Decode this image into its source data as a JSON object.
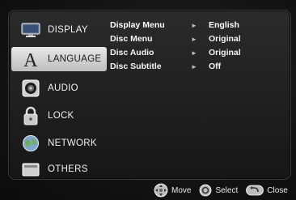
{
  "sidebar": {
    "items": [
      {
        "label": "DISPLAY",
        "icon": "display-icon"
      },
      {
        "label": "LANGUAGE",
        "icon": "language-icon"
      },
      {
        "label": "AUDIO",
        "icon": "audio-icon"
      },
      {
        "label": "LOCK",
        "icon": "lock-icon"
      },
      {
        "label": "NETWORK",
        "icon": "network-icon"
      },
      {
        "label": "OTHERS",
        "icon": "others-icon"
      }
    ],
    "selected": "LANGUAGE"
  },
  "settings": [
    {
      "label": "Display Menu",
      "value": "English"
    },
    {
      "label": "Disc Menu",
      "value": "Original"
    },
    {
      "label": "Disc Audio",
      "value": "Original"
    },
    {
      "label": "Disc Subtitle",
      "value": "Off"
    }
  ],
  "footer": {
    "move_label": "Move",
    "select_label": "Select",
    "close_label": "Close"
  }
}
